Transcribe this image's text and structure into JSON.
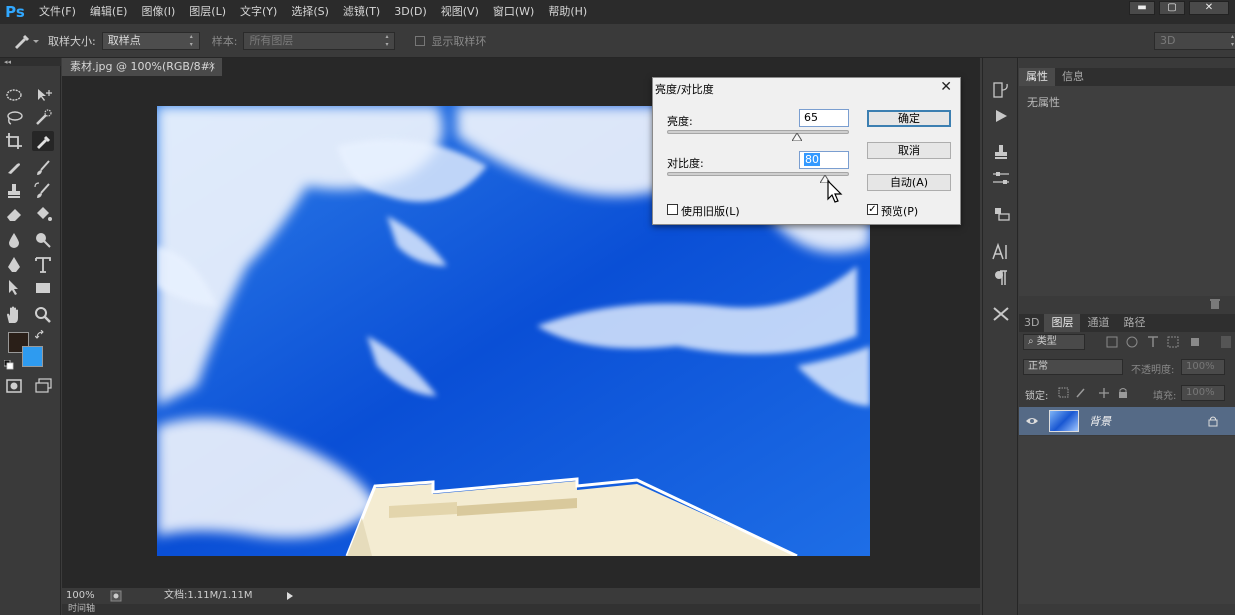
{
  "app": {
    "logo": "Ps"
  },
  "menu": [
    "文件(F)",
    "编辑(E)",
    "图像(I)",
    "图层(L)",
    "文字(Y)",
    "选择(S)",
    "滤镜(T)",
    "3D(D)",
    "视图(V)",
    "窗口(W)",
    "帮助(H)"
  ],
  "window_controls": {
    "minimize": "▬",
    "maximize": "▢",
    "close": "✕"
  },
  "options_bar": {
    "sample_size_label": "取样大小:",
    "sample_size_value": "取样点",
    "sample_label": "样本:",
    "sample_value": "所有图层",
    "show_ring_label": "显示取样环",
    "workspace_value": "3D"
  },
  "document": {
    "tab_title": "素材.jpg @ 100%(RGB/8#)",
    "tab_close": "×",
    "zoom": "100%",
    "doc_size": "文档:1.11M/1.11M",
    "timeline_label": "时间轴"
  },
  "dialog": {
    "title": "亮度/对比度",
    "close": "✕",
    "brightness_label": "亮度:",
    "brightness_value": "65",
    "contrast_label": "对比度:",
    "contrast_value": "80",
    "ok_label": "确定",
    "cancel_label": "取消",
    "auto_label": "自动(A)",
    "legacy_label": "使用旧版(L)",
    "legacy_checked": false,
    "preview_label": "预览(P)",
    "preview_checked": true
  },
  "properties_panel": {
    "tabs": [
      "属性",
      "信息"
    ],
    "active_tab": 0,
    "empty_text": "无属性"
  },
  "layers_panel": {
    "tabs": [
      "3D",
      "图层",
      "通道",
      "路径"
    ],
    "active_tab": 1,
    "filter_kind": "类型",
    "blend_mode": "正常",
    "opacity_label": "不透明度:",
    "opacity_value": "100%",
    "lock_label": "锁定:",
    "fill_label": "填充:",
    "fill_value": "100%",
    "layers": [
      {
        "name": "背景",
        "visible": true,
        "locked": true
      }
    ]
  },
  "colors": {
    "foreground": "#2a1f18",
    "background": "#2e9bf0",
    "dialog_accent": "#3c7fb1",
    "layer_selected": "#556a86",
    "ps_blue": "#31a8ff"
  }
}
